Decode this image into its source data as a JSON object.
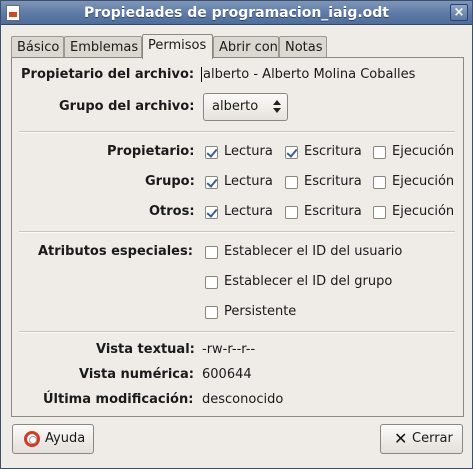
{
  "window": {
    "title": "Propiedades de programacion_iaig.odt",
    "close_glyph": "×"
  },
  "tabs": [
    "Básico",
    "Emblemas",
    "Permisos",
    "Abrir con",
    "Notas"
  ],
  "owner": {
    "label": "Propietario del archivo:",
    "value": "alberto - Alberto Molina Coballes"
  },
  "group_file": {
    "label": "Grupo del archivo:",
    "value": "alberto"
  },
  "permissions": {
    "rows": [
      {
        "label": "Propietario:",
        "read": "Lectura",
        "write": "Escritura",
        "exec": "Ejecución"
      },
      {
        "label": "Grupo:",
        "read": "Lectura",
        "write": "Escritura",
        "exec": "Ejecución"
      },
      {
        "label": "Otros:",
        "read": "Lectura",
        "write": "Escritura",
        "exec": "Ejecución"
      }
    ],
    "checked": [
      [
        true,
        true,
        false
      ],
      [
        true,
        false,
        false
      ],
      [
        true,
        false,
        false
      ]
    ]
  },
  "special": {
    "label": "Atributos especiales:",
    "options": [
      "Establecer el ID del usuario",
      "Establecer el ID del grupo",
      "Persistente"
    ],
    "checked": [
      false,
      false,
      false
    ]
  },
  "info": {
    "text_view_label": "Vista textual:",
    "text_view_value": "-rw-r--r--",
    "numeric_view_label": "Vista numérica:",
    "numeric_view_value": "600644",
    "modified_label": "Última modificación:",
    "modified_value": "desconocido"
  },
  "buttons": {
    "help": "Ayuda",
    "close": "Cerrar"
  },
  "icons": {
    "help": "lifebuoy-icon",
    "close": "x-icon",
    "window": "document-icon"
  }
}
